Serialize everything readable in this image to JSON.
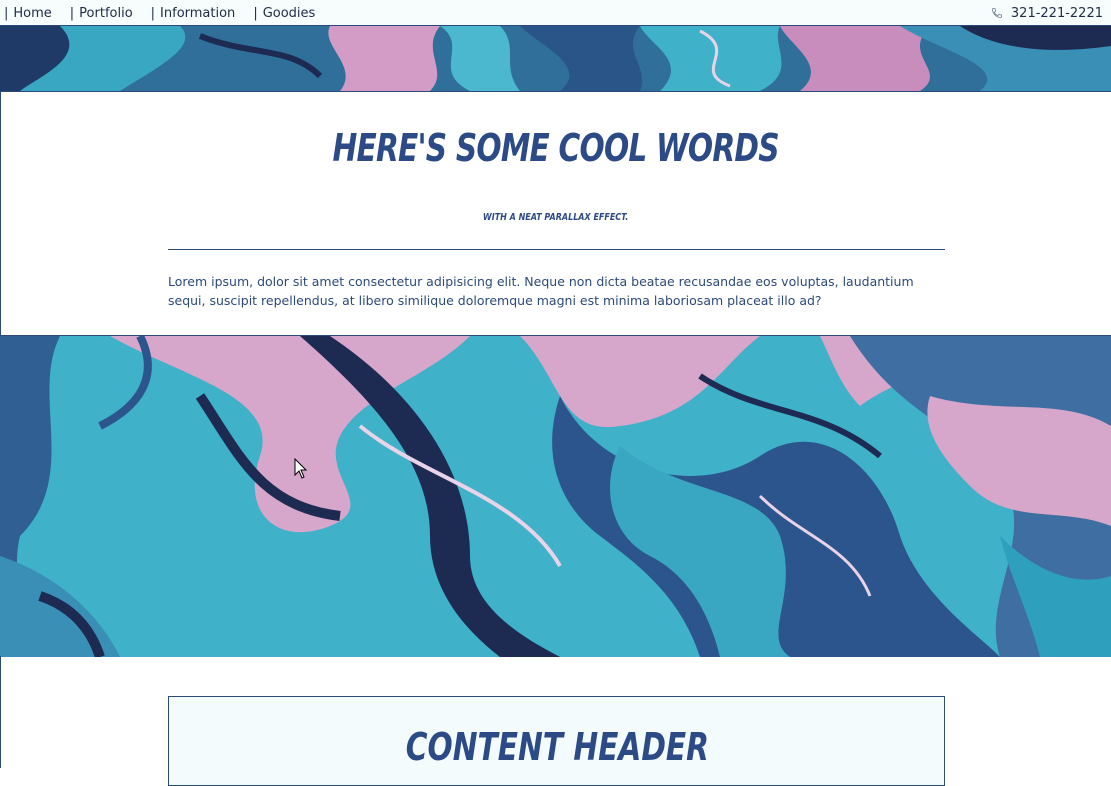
{
  "nav": {
    "items": [
      {
        "pipe": "|",
        "label": "Home"
      },
      {
        "pipe": "|",
        "label": "Portfolio"
      },
      {
        "pipe": "|",
        "label": "Information"
      },
      {
        "pipe": "|",
        "label": "Goodies"
      }
    ],
    "phone_icon": "phone-icon",
    "phone": "321-221-2221"
  },
  "hero": {
    "title": "Here's some cool words",
    "subtitle": "with a neat parallax effect.",
    "body": "Lorem ipsum, dolor sit amet consectetur adipisicing elit. Neque non dicta beatae recusandae eos voluptas, laudantium sequi, suscipit repellendus, at libero similique doloremque magni est minima laboriosam placeat illo ad?"
  },
  "content": {
    "title": "Content Header"
  },
  "colors": {
    "brand_navy": "#2c4a86",
    "teal": "#3fb1c8",
    "pink": "#d7a1c8",
    "dark": "#1d2a52"
  }
}
